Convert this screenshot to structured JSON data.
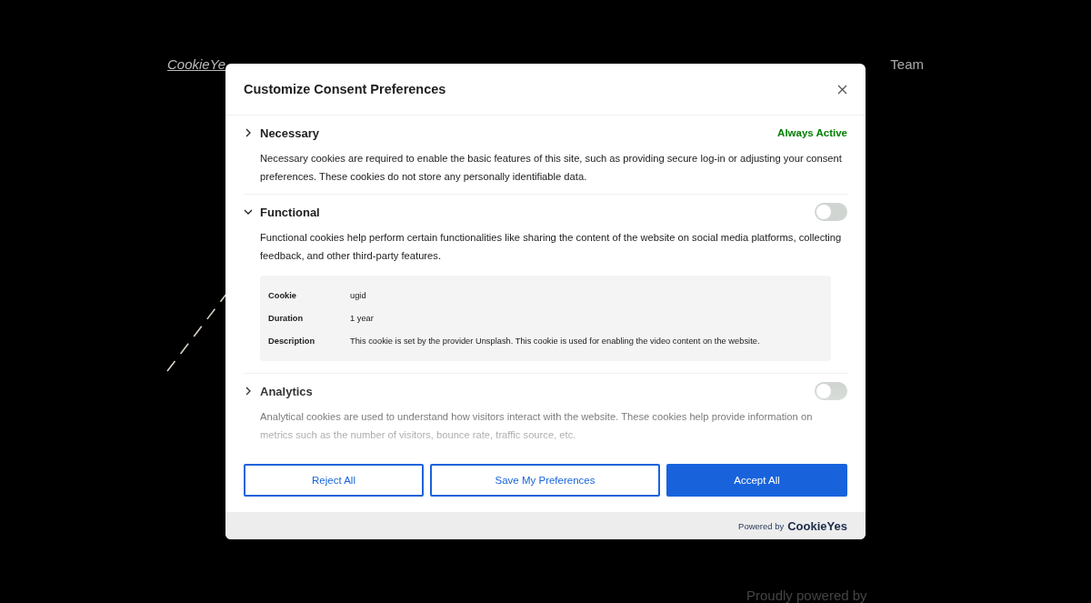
{
  "site": {
    "logo": "CookieYe",
    "nav": [
      "Team"
    ],
    "footer": "Proudly powered by"
  },
  "modal": {
    "title": "Customize Consent Preferences",
    "categories": [
      {
        "kind": "always_active",
        "name": "Necessary",
        "expanded": false,
        "status": "Always Active",
        "description": "Necessary cookies are required to enable the basic features of this site, such as providing secure log-in or adjusting your consent preferences. These cookies do not store any personally identifiable data."
      },
      {
        "kind": "toggle",
        "name": "Functional",
        "expanded": true,
        "on": false,
        "description": "Functional cookies help perform certain functionalities like sharing the content of the website on social media platforms, collecting feedback, and other third-party features.",
        "cookies": [
          {
            "rows": [
              {
                "label": "Cookie",
                "value": "ugid"
              },
              {
                "label": "Duration",
                "value": "1 year"
              },
              {
                "label": "Description",
                "value": "This cookie is set by the provider Unsplash. This cookie is used for enabling the video content on the website."
              }
            ]
          }
        ]
      },
      {
        "kind": "toggle",
        "name": "Analytics",
        "expanded": false,
        "on": false,
        "description": "Analytical cookies are used to understand how visitors interact with the website. These cookies help provide information on metrics such as the number of visitors, bounce rate, traffic source, etc."
      }
    ],
    "buttons": [
      {
        "label": "Reject All",
        "kind": "outline"
      },
      {
        "label": "Save My Preferences",
        "kind": "outline"
      },
      {
        "label": "Accept All",
        "kind": "primary"
      }
    ],
    "powered_by": "Powered by",
    "brand": "CookieYes"
  }
}
